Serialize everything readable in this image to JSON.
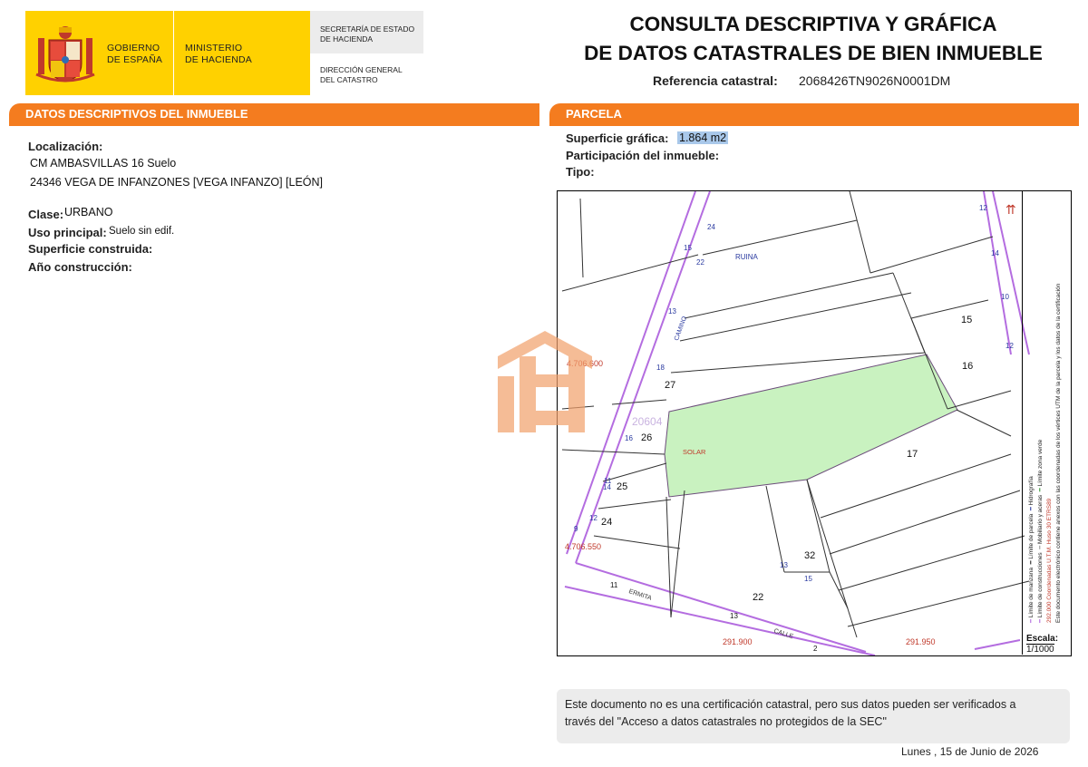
{
  "header": {
    "gobierno": [
      "GOBIERNO",
      "DE ESPAÑA"
    ],
    "ministerio": [
      "MINISTERIO",
      "DE HACIENDA"
    ],
    "secretaria": [
      "SECRETARÍA DE ESTADO",
      "DE HACIENDA"
    ],
    "direccion": [
      "DIRECCIÓN GENERAL",
      "DEL CATASTRO"
    ],
    "title_line1": "CONSULTA DESCRIPTIVA Y GRÁFICA",
    "title_line2": "DE DATOS CATASTRALES DE BIEN INMUEBLE",
    "ref_label": "Referencia catastral:",
    "ref_value": "2068426TN9026N0001DM"
  },
  "colors": {
    "accent": "#f47c1f",
    "brand_yellow": "#ffd100",
    "parcel_fill": "#c9f2c0",
    "parcel_line": "#b46de0"
  },
  "left": {
    "section_title": "DATOS DESCRIPTIVOS DEL INMUEBLE",
    "localizacion_label": "Localización:",
    "localizacion_line1": "CM AMBASVILLAS 16 Suelo",
    "localizacion_line2": "24346 VEGA DE INFANZONES [VEGA INFANZO] [LEÓN]",
    "clase_label": "Clase:",
    "clase_value": "URBANO",
    "uso_label": "Uso principal:",
    "uso_value": "Suelo sin edif.",
    "superficie_label": "Superficie construida:",
    "anio_label": "Año construcción:"
  },
  "right": {
    "section_title": "PARCELA",
    "superficie_label": "Superficie gráfica:",
    "superficie_value": "1.864 m2",
    "participacion_label": "Participación del inmueble:",
    "tipo_label": "Tipo:"
  },
  "map": {
    "labels": {
      "ruina": "RUINA",
      "solar": "SOLAR",
      "parcel_id": "20604",
      "coord_n1": "4.706.600",
      "coord_n2": "4.706.550",
      "coord_e1": "291.900",
      "coord_e2": "291.950",
      "ermita": "ERMITA",
      "calle": "CALLE",
      "camino": "CAMINO",
      "p15": "15",
      "p16": "16",
      "p17": "17",
      "p22": "22",
      "p24": "24",
      "p25": "25",
      "p26": "26",
      "p27": "27",
      "p32": "32",
      "n15": "15",
      "n22": "22",
      "n24": "24",
      "n13": "13",
      "n18": "18",
      "n16": "16",
      "n11": "11",
      "n14": "14",
      "n12": "12",
      "n9": "9",
      "n10": "10",
      "n13b": "13",
      "n15b": "15",
      "n11b": "11",
      "n13c": "13",
      "n2": "2",
      "n12b": "12",
      "n14b": "14",
      "n10b": "10",
      "n12c": "12"
    },
    "legend": {
      "manzana": "Límite de manzana",
      "construcciones": "Límite de construcciones",
      "parcela": "Límite de parcela",
      "mobiliario": "Mobiliario y aceras",
      "hidrografia": "Hidrografía",
      "zona_verde": "Límite zona verde",
      "coords": "292.000 Coordenadas U.T.M. Huso 30 ETRS89",
      "doc_note": "Este documento electrónico contiene anexos con las coordenadas de los vértices UTM de la parcela y los datos de la certificación"
    },
    "scale_label": "Escala:",
    "scale_value": "1/1000"
  },
  "footer": {
    "line1": "Este documento no es una certificación catastral, pero sus datos pueden ser verificados a",
    "line2": "través del \"Acceso a datos catastrales no protegidos de la SEC\"",
    "date": "Lunes , 15 de Junio de 2026"
  }
}
